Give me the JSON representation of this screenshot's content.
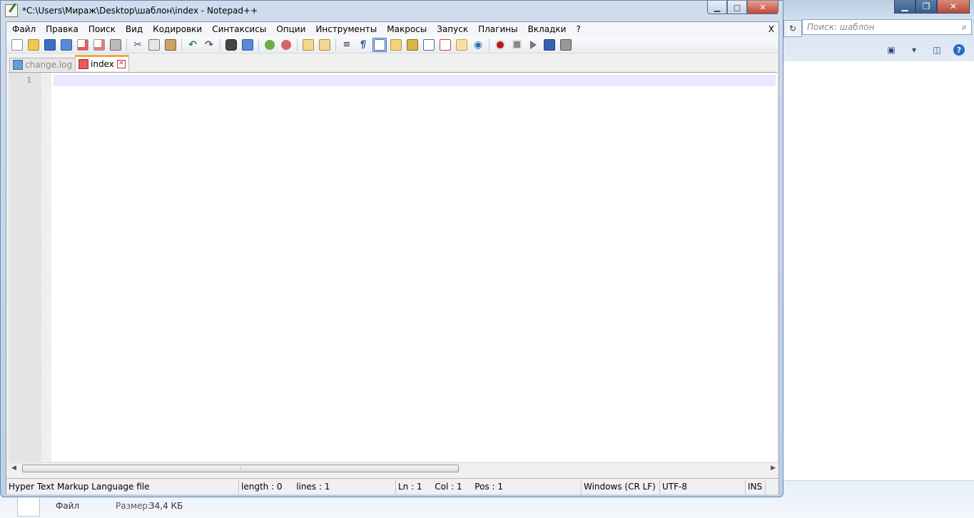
{
  "explorer": {
    "search_placeholder": "Поиск: шаблон",
    "details": {
      "type": "Файл",
      "size_label": "Размер:",
      "size_value": "34,4 КБ"
    }
  },
  "npp": {
    "title": "*C:\\Users\\Мираж\\Desktop\\шаблон\\index - Notepad++",
    "menu": [
      "Файл",
      "Правка",
      "Поиск",
      "Вид",
      "Кодировки",
      "Синтаксисы",
      "Опции",
      "Инструменты",
      "Макросы",
      "Запуск",
      "Плагины",
      "Вкладки",
      "?"
    ],
    "menu_close": "X",
    "tabs": [
      {
        "label": "change.log",
        "active": false
      },
      {
        "label": "index",
        "active": true
      }
    ],
    "line_numbers": [
      "1"
    ],
    "status": {
      "file_type": "Hyper Text Markup Language file",
      "length": "length : 0",
      "lines": "lines : 1",
      "ln": "Ln : 1",
      "col": "Col : 1",
      "pos": "Pos : 1",
      "eol": "Windows (CR LF)",
      "encoding": "UTF-8",
      "mode": "INS"
    }
  }
}
